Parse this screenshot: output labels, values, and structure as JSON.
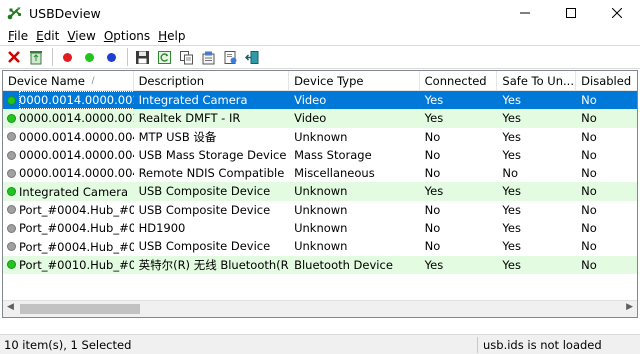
{
  "window": {
    "title": "USBDeview"
  },
  "menu": [
    {
      "label": "File",
      "u": "F",
      "rest": "ile"
    },
    {
      "label": "Edit",
      "u": "E",
      "rest": "dit"
    },
    {
      "label": "View",
      "u": "V",
      "rest": "iew"
    },
    {
      "label": "Options",
      "u": "O",
      "rest": "ptions"
    },
    {
      "label": "Help",
      "u": "H",
      "rest": "elp"
    }
  ],
  "columns": [
    "Device Name",
    "Description",
    "Device Type",
    "Connected",
    "Safe To Un...",
    "Disabled"
  ],
  "rows": [
    {
      "status": "green",
      "name": "0000.0014.0000.001...",
      "description": "Integrated Camera",
      "type": "Video",
      "connected": "Yes",
      "safe": "Yes",
      "disabled": "No",
      "selected": true
    },
    {
      "status": "green",
      "name": "0000.0014.0000.001...",
      "description": "Realtek DMFT - IR",
      "type": "Video",
      "connected": "Yes",
      "safe": "Yes",
      "disabled": "No"
    },
    {
      "status": "gray",
      "name": "0000.0014.0000.004...",
      "description": "MTP USB 设备",
      "type": "Unknown",
      "connected": "No",
      "safe": "Yes",
      "disabled": "No"
    },
    {
      "status": "gray",
      "name": "0000.0014.0000.004...",
      "description": "USB Mass Storage Device",
      "type": "Mass Storage",
      "connected": "No",
      "safe": "Yes",
      "disabled": "No"
    },
    {
      "status": "gray",
      "name": "0000.0014.0000.004...",
      "description": "Remote NDIS Compatible ...",
      "type": "Miscellaneous",
      "connected": "No",
      "safe": "No",
      "disabled": "No"
    },
    {
      "status": "green",
      "name": "Integrated Camera",
      "description": "USB Composite Device",
      "type": "Unknown",
      "connected": "Yes",
      "safe": "Yes",
      "disabled": "No"
    },
    {
      "status": "gray",
      "name": "Port_#0004.Hub_#0...",
      "description": "USB Composite Device",
      "type": "Unknown",
      "connected": "No",
      "safe": "Yes",
      "disabled": "No"
    },
    {
      "status": "gray",
      "name": "Port_#0004.Hub_#0...",
      "description": "HD1900",
      "type": "Unknown",
      "connected": "No",
      "safe": "Yes",
      "disabled": "No"
    },
    {
      "status": "gray",
      "name": "Port_#0004.Hub_#0...",
      "description": "USB Composite Device",
      "type": "Unknown",
      "connected": "No",
      "safe": "Yes",
      "disabled": "No"
    },
    {
      "status": "green",
      "name": "Port_#0010.Hub_#0...",
      "description": "英特尔(R) 无线 Bluetooth(R)",
      "type": "Bluetooth Device",
      "connected": "Yes",
      "safe": "Yes",
      "disabled": "No"
    }
  ],
  "status": {
    "count": "10 item(s), 1 Selected",
    "usbids": "usb.ids is not loaded"
  },
  "colors": {
    "selected": "#0078d7",
    "connected_row": "#e3fbe0",
    "green_dot": "#22c51f",
    "gray_dot": "#a0a0a0"
  }
}
